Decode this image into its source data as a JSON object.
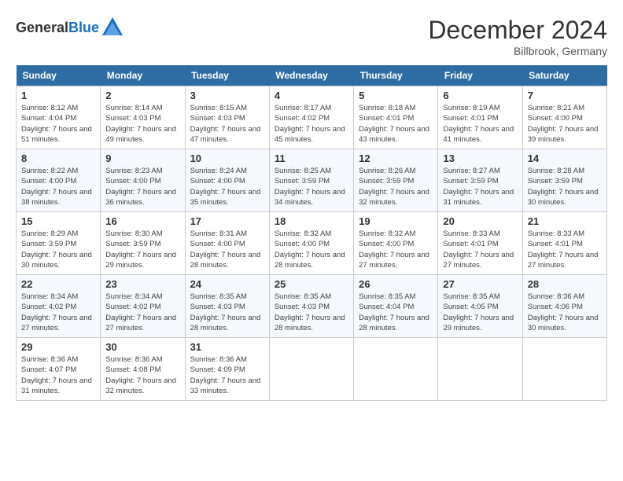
{
  "header": {
    "logo_general": "General",
    "logo_blue": "Blue",
    "month_title": "December 2024",
    "location": "Billbrook, Germany"
  },
  "columns": [
    "Sunday",
    "Monday",
    "Tuesday",
    "Wednesday",
    "Thursday",
    "Friday",
    "Saturday"
  ],
  "weeks": [
    [
      {
        "day": "1",
        "sunrise": "8:12 AM",
        "sunset": "4:04 PM",
        "daylight": "7 hours and 51 minutes."
      },
      {
        "day": "2",
        "sunrise": "8:14 AM",
        "sunset": "4:03 PM",
        "daylight": "7 hours and 49 minutes."
      },
      {
        "day": "3",
        "sunrise": "8:15 AM",
        "sunset": "4:03 PM",
        "daylight": "7 hours and 47 minutes."
      },
      {
        "day": "4",
        "sunrise": "8:17 AM",
        "sunset": "4:02 PM",
        "daylight": "7 hours and 45 minutes."
      },
      {
        "day": "5",
        "sunrise": "8:18 AM",
        "sunset": "4:01 PM",
        "daylight": "7 hours and 43 minutes."
      },
      {
        "day": "6",
        "sunrise": "8:19 AM",
        "sunset": "4:01 PM",
        "daylight": "7 hours and 41 minutes."
      },
      {
        "day": "7",
        "sunrise": "8:21 AM",
        "sunset": "4:00 PM",
        "daylight": "7 hours and 39 minutes."
      }
    ],
    [
      {
        "day": "8",
        "sunrise": "8:22 AM",
        "sunset": "4:00 PM",
        "daylight": "7 hours and 38 minutes."
      },
      {
        "day": "9",
        "sunrise": "8:23 AM",
        "sunset": "4:00 PM",
        "daylight": "7 hours and 36 minutes."
      },
      {
        "day": "10",
        "sunrise": "8:24 AM",
        "sunset": "4:00 PM",
        "daylight": "7 hours and 35 minutes."
      },
      {
        "day": "11",
        "sunrise": "8:25 AM",
        "sunset": "3:59 PM",
        "daylight": "7 hours and 34 minutes."
      },
      {
        "day": "12",
        "sunrise": "8:26 AM",
        "sunset": "3:59 PM",
        "daylight": "7 hours and 32 minutes."
      },
      {
        "day": "13",
        "sunrise": "8:27 AM",
        "sunset": "3:59 PM",
        "daylight": "7 hours and 31 minutes."
      },
      {
        "day": "14",
        "sunrise": "8:28 AM",
        "sunset": "3:59 PM",
        "daylight": "7 hours and 30 minutes."
      }
    ],
    [
      {
        "day": "15",
        "sunrise": "8:29 AM",
        "sunset": "3:59 PM",
        "daylight": "7 hours and 30 minutes."
      },
      {
        "day": "16",
        "sunrise": "8:30 AM",
        "sunset": "3:59 PM",
        "daylight": "7 hours and 29 minutes."
      },
      {
        "day": "17",
        "sunrise": "8:31 AM",
        "sunset": "4:00 PM",
        "daylight": "7 hours and 28 minutes."
      },
      {
        "day": "18",
        "sunrise": "8:32 AM",
        "sunset": "4:00 PM",
        "daylight": "7 hours and 28 minutes."
      },
      {
        "day": "19",
        "sunrise": "8:32 AM",
        "sunset": "4:00 PM",
        "daylight": "7 hours and 27 minutes."
      },
      {
        "day": "20",
        "sunrise": "8:33 AM",
        "sunset": "4:01 PM",
        "daylight": "7 hours and 27 minutes."
      },
      {
        "day": "21",
        "sunrise": "8:33 AM",
        "sunset": "4:01 PM",
        "daylight": "7 hours and 27 minutes."
      }
    ],
    [
      {
        "day": "22",
        "sunrise": "8:34 AM",
        "sunset": "4:02 PM",
        "daylight": "7 hours and 27 minutes."
      },
      {
        "day": "23",
        "sunrise": "8:34 AM",
        "sunset": "4:02 PM",
        "daylight": "7 hours and 27 minutes."
      },
      {
        "day": "24",
        "sunrise": "8:35 AM",
        "sunset": "4:03 PM",
        "daylight": "7 hours and 28 minutes."
      },
      {
        "day": "25",
        "sunrise": "8:35 AM",
        "sunset": "4:03 PM",
        "daylight": "7 hours and 28 minutes."
      },
      {
        "day": "26",
        "sunrise": "8:35 AM",
        "sunset": "4:04 PM",
        "daylight": "7 hours and 28 minutes."
      },
      {
        "day": "27",
        "sunrise": "8:35 AM",
        "sunset": "4:05 PM",
        "daylight": "7 hours and 29 minutes."
      },
      {
        "day": "28",
        "sunrise": "8:36 AM",
        "sunset": "4:06 PM",
        "daylight": "7 hours and 30 minutes."
      }
    ],
    [
      {
        "day": "29",
        "sunrise": "8:36 AM",
        "sunset": "4:07 PM",
        "daylight": "7 hours and 31 minutes."
      },
      {
        "day": "30",
        "sunrise": "8:36 AM",
        "sunset": "4:08 PM",
        "daylight": "7 hours and 32 minutes."
      },
      {
        "day": "31",
        "sunrise": "8:36 AM",
        "sunset": "4:09 PM",
        "daylight": "7 hours and 33 minutes."
      },
      null,
      null,
      null,
      null
    ]
  ],
  "labels": {
    "sunrise": "Sunrise:",
    "sunset": "Sunset:",
    "daylight": "Daylight:"
  }
}
